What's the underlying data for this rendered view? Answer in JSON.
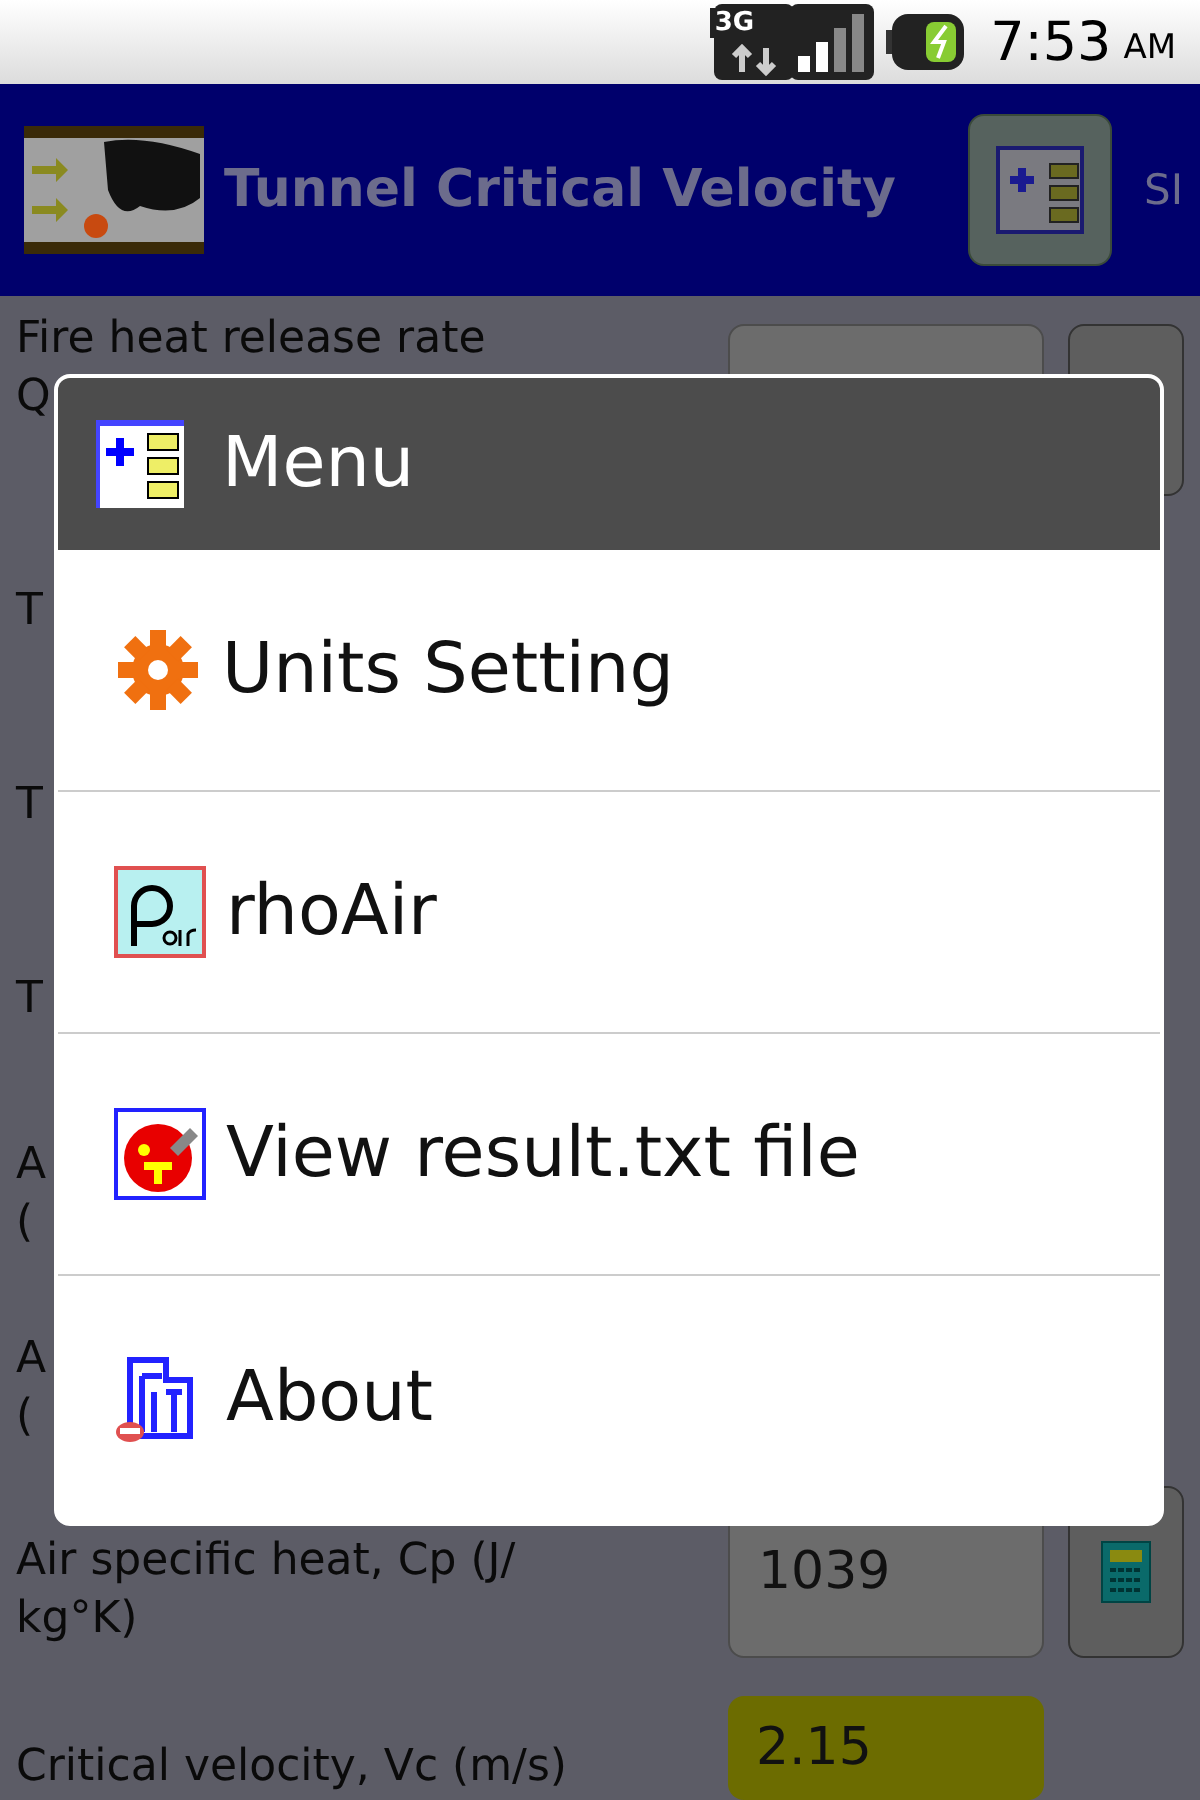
{
  "status_bar": {
    "network": "3G",
    "time": "7:53",
    "ampm": "AM"
  },
  "title_bar": {
    "title": "Tunnel Critical Velocity",
    "units": "SI"
  },
  "form": {
    "rows": [
      {
        "label": [
          "Fire heat release rate",
          "Q"
        ],
        "kind": "input",
        "button": true
      },
      {
        "label": [
          "T"
        ]
      },
      {
        "label": [
          "T"
        ]
      },
      {
        "label": [
          "T"
        ]
      },
      {
        "label": [
          "A",
          "("
        ]
      },
      {
        "label": [
          "A",
          "("
        ]
      },
      {
        "label": [
          "Air specific heat, Cp (J/",
          "kg°K)"
        ],
        "kind": "input",
        "value": "1039",
        "button": true,
        "button_icon": true
      },
      {
        "label": [
          "Critical velocity, Vc (m/s)"
        ],
        "kind": "output",
        "value": "2.15"
      }
    ]
  },
  "menu": {
    "title": "Menu",
    "items": [
      {
        "kind": "gear",
        "label": "Units Setting"
      },
      {
        "kind": "rho",
        "label": "rhoAir"
      },
      {
        "kind": "face",
        "label": "View result.txt file"
      },
      {
        "kind": "about",
        "label": "About"
      }
    ]
  }
}
